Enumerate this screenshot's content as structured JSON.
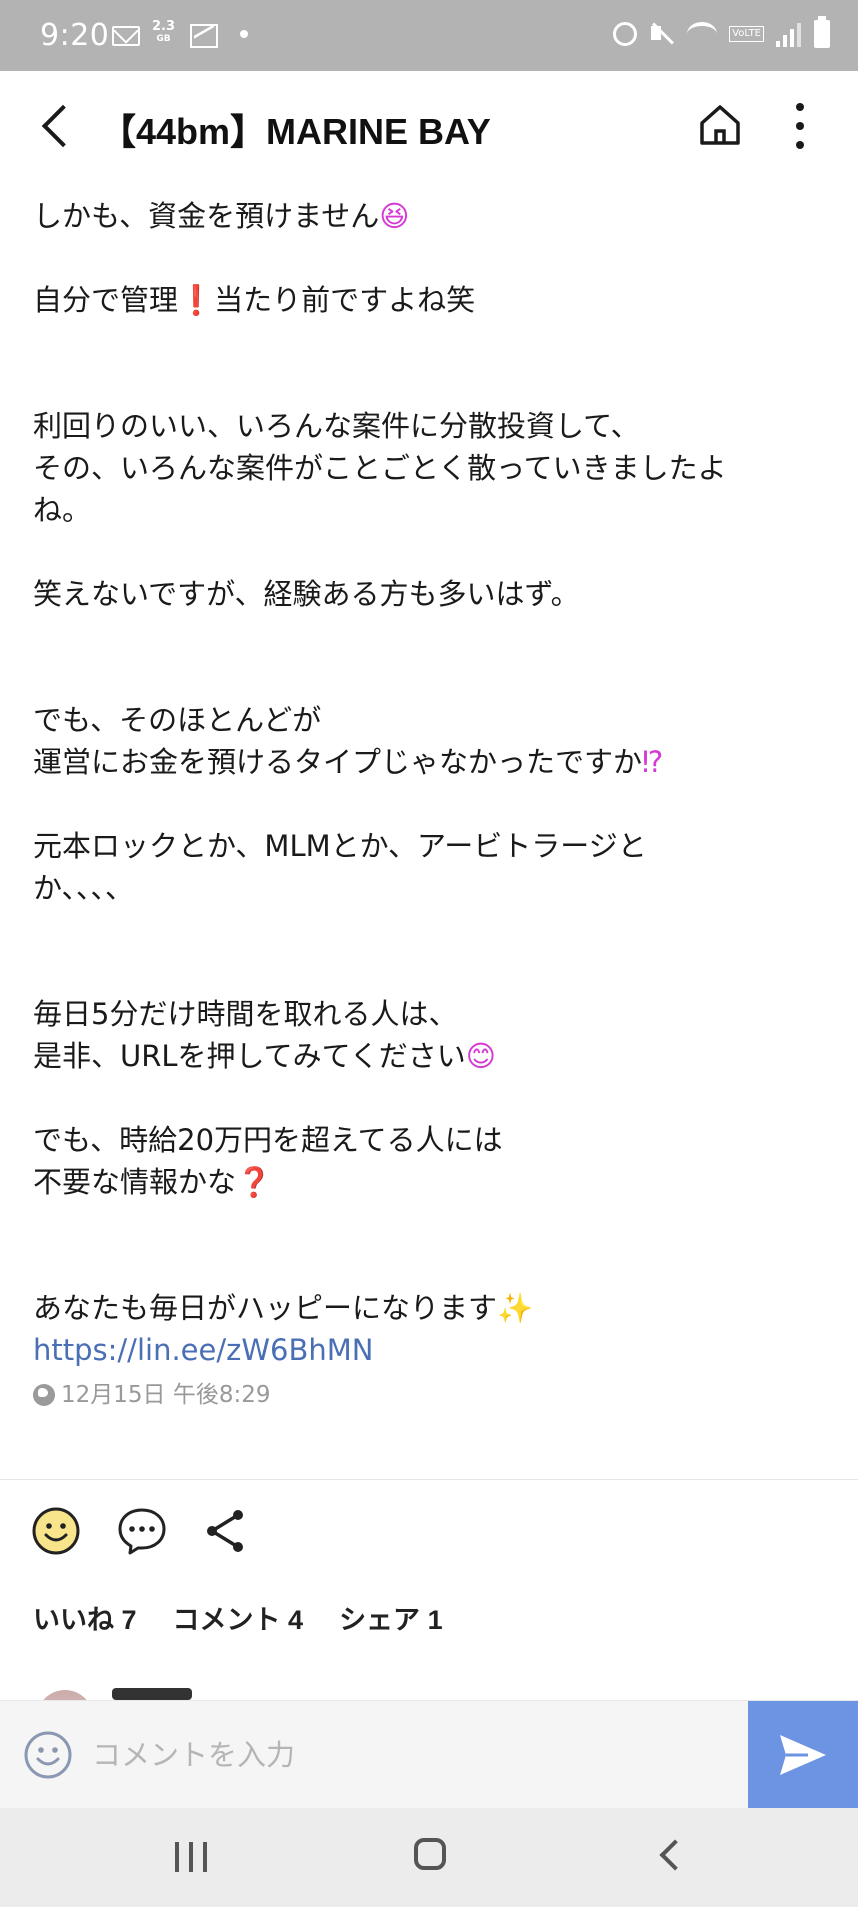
{
  "status_bar": {
    "time": "9:20",
    "data_amount": "2.3",
    "data_unit": "GB",
    "volte": "VoLTE"
  },
  "header": {
    "title": "【44bm】MARINE BAY"
  },
  "post": {
    "lines": {
      "l1": "しかも、資金を預けません",
      "l1_emoji": "😆",
      "l2_a": "自分で管理",
      "l2_emoji": "❗",
      "l2_b": "当たり前ですよね笑",
      "l3": "利回りのいい、いろんな案件に分散投資して、",
      "l4": "その、いろんな案件がことごとく散っていきましたよ",
      "l5": "ね。",
      "l6": "笑えないですが、経験ある方も多いはず。",
      "l7": "でも、そのほとんどが",
      "l8": "運営にお金を預けるタイプじゃなかったですか",
      "l8_emoji": "⁉",
      "l9": "元本ロックとか、MLMとか、アービトラージと",
      "l10": "か、、、、",
      "l11": "毎日5分だけ時間を取れる人は、",
      "l12": "是非、URLを押してみてください",
      "l12_emoji": "😊",
      "l13": "でも、時給20万円を超えてる人には",
      "l14": "不要な情報かな",
      "l14_emoji": "❓",
      "l15": "あなたも毎日がハッピーになります",
      "l15_emoji": "✨",
      "link": "https://lin.ee/zW6BhMN"
    },
    "timestamp": "12月15日 午後8:29"
  },
  "actions": {
    "like_icon": "smile-face-icon",
    "comment_icon": "speech-bubble-icon",
    "share_icon": "share-icon"
  },
  "counts": {
    "likes": "いいね 7",
    "comments": "コメント 4",
    "shares": "シェア 1"
  },
  "comment_bar": {
    "placeholder": "コメントを入力",
    "value": ""
  },
  "colors": {
    "status_bar": "#b3b3b3",
    "link": "#4a6fb5",
    "send_button": "#6d93e3",
    "timestamp": "#999999"
  }
}
